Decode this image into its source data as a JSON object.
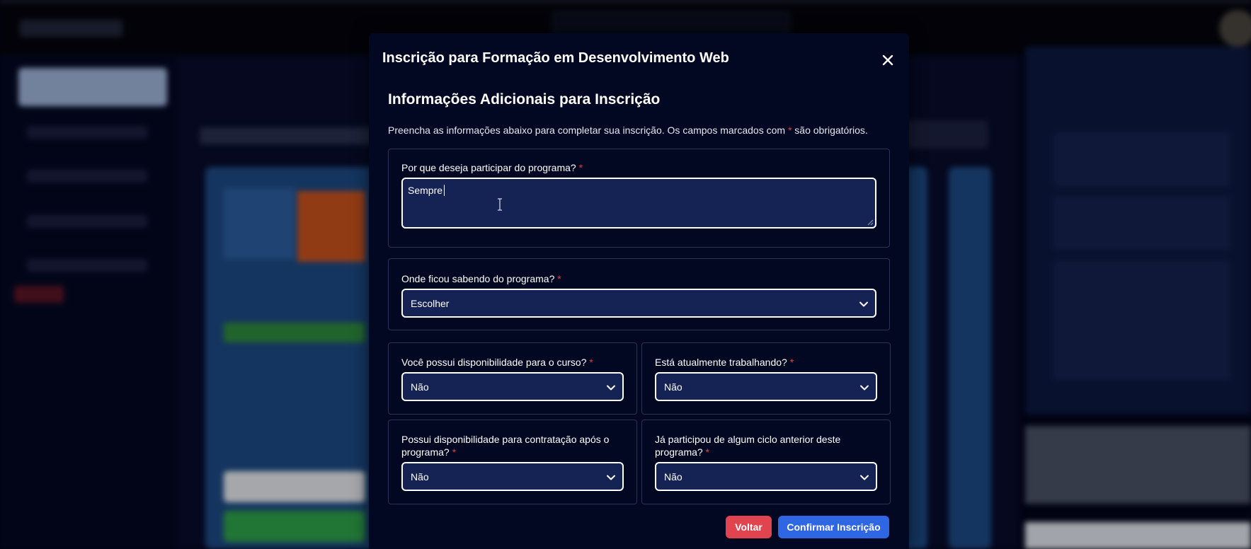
{
  "modal": {
    "title": "Inscrição para Formação em Desenvolvimento Web",
    "section_title": "Informações Adicionais para Inscrição",
    "intro_prefix": "Preencha as informações abaixo para completar sua inscrição. Os campos marcados com",
    "required_mark": "*",
    "intro_suffix": "são obrigatórios."
  },
  "fields": {
    "motivation": {
      "label": "Por que deseja participar do programa?",
      "value": "Sempre"
    },
    "source": {
      "label": "Onde ficou sabendo do programa?",
      "selected": "Escolher"
    },
    "availability": {
      "label": "Você possui disponibilidade para o curso?",
      "selected": "Não"
    },
    "working": {
      "label": "Está atualmente trabalhando?",
      "selected": "Não"
    },
    "hiring_availability": {
      "label": "Possui disponibilidade para contratação após o programa?",
      "selected": "Não"
    },
    "previous_cycle": {
      "label": "Já participou de algum ciclo anterior deste programa?",
      "selected": "Não"
    }
  },
  "buttons": {
    "back": "Voltar",
    "confirm": "Confirmar Inscrição"
  },
  "colors": {
    "modal_bg": "#020722",
    "control_bg": "#152254",
    "required": "#e03a48",
    "back_button": "#e0444f",
    "confirm_button": "#2f66e3"
  },
  "icons": {
    "close": "close-icon",
    "select_arrow": "chevron-down-icon",
    "text_cursor": "text-cursor-icon"
  }
}
